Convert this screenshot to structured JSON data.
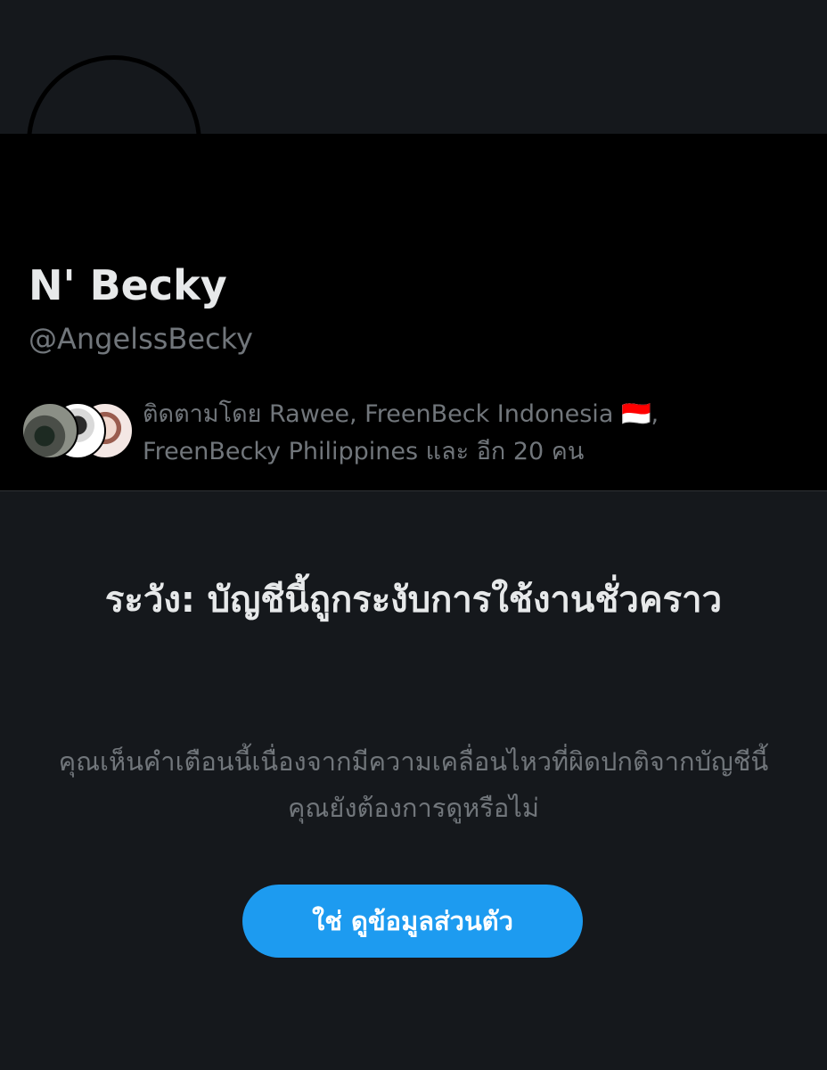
{
  "profile": {
    "display_name": "N' Becky",
    "handle": "@AngelssBecky",
    "followed_by": "ติดตามโดย Rawee, FreenBeck Indonesia 🇮🇩, FreenBecky Philippines และ อีก 20 คน"
  },
  "warning": {
    "title": "ระวัง: บัญชีนี้ถูกระงับการใช้งานชั่วคราว",
    "body": "คุณเห็นคำเตือนนี้เนื่องจากมีความเคลื่อนไหวที่ผิดปกติจากบัญชีนี้ คุณยังต้องการดูหรือไม่",
    "button_label": "ใช่ ดูข้อมูลส่วนตัว"
  },
  "colors": {
    "background": "#15181c",
    "profile_background": "#000000",
    "primary_text": "#e7e9ea",
    "secondary_text": "#71767b",
    "accent": "#1d9bf0"
  }
}
